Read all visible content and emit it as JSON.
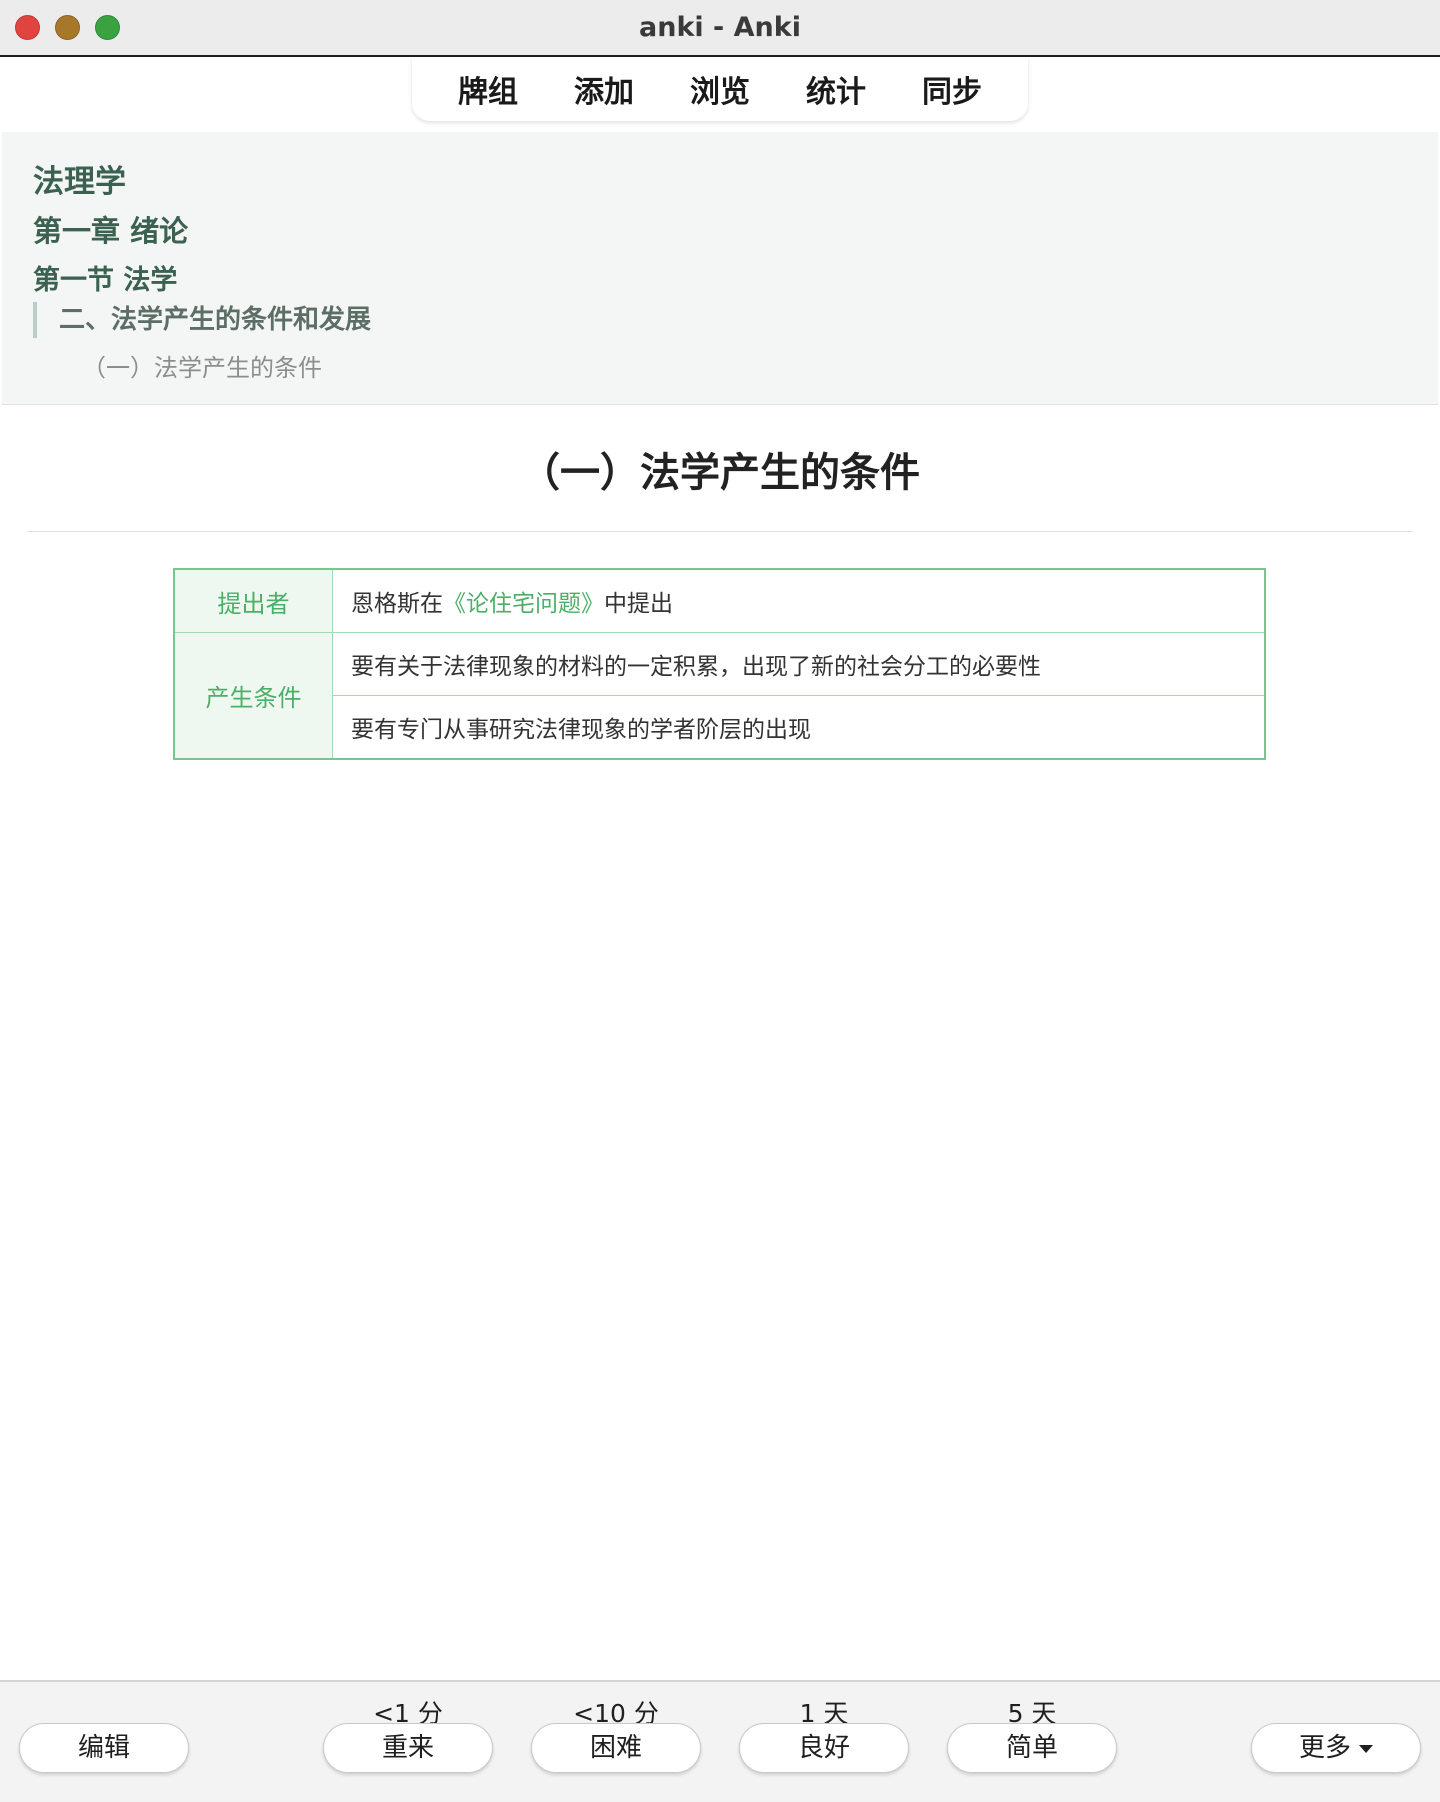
{
  "window": {
    "title": "anki - Anki"
  },
  "toolbar": {
    "items": [
      {
        "label": "牌组"
      },
      {
        "label": "添加"
      },
      {
        "label": "浏览"
      },
      {
        "label": "统计"
      },
      {
        "label": "同步"
      }
    ]
  },
  "context": {
    "subject": "法理学",
    "chapter": "第一章 绪论",
    "section": "第一节 法学",
    "topic": "二、法学产生的条件和发展",
    "subtopic": "（一）法学产生的条件"
  },
  "card": {
    "heading": "（一）法学产生的条件",
    "table": {
      "proposer_label": "提出者",
      "proposer_prefix": "恩格斯在",
      "proposer_book": "《论住宅问题》",
      "proposer_suffix": "中提出",
      "conditions_label": "产生条件",
      "condition_1": "要有关于法律现象的材料的一定积累，出现了新的社会分工的必要性",
      "condition_2": "要有专门从事研究法律现象的学者阶层的出现"
    }
  },
  "review": {
    "edit_label": "编辑",
    "more_label": "更多",
    "answers": [
      {
        "interval": "<1 分",
        "label": "重来"
      },
      {
        "interval": "<10 分",
        "label": "困难"
      },
      {
        "interval": "1 天",
        "label": "良好"
      },
      {
        "interval": "5 天",
        "label": "简单"
      }
    ]
  },
  "colors": {
    "accent_green": "#4caf68",
    "context_green": "#3b6150",
    "traffic_close": "#e0443e",
    "traffic_minimize": "#a8782a",
    "traffic_maximize": "#3ba241"
  }
}
